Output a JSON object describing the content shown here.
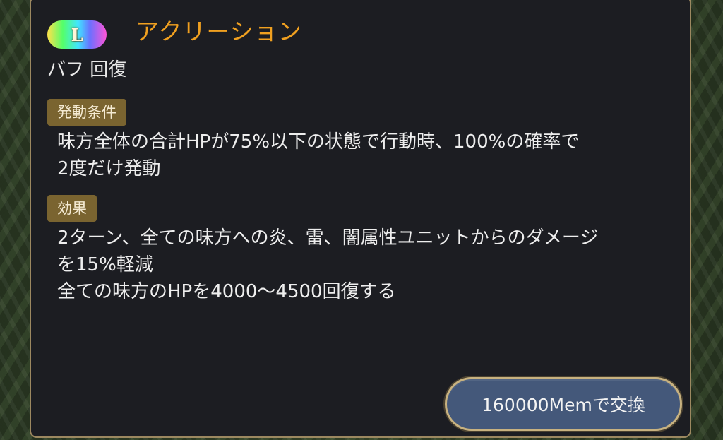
{
  "skill": {
    "rarity": "L",
    "name": "アクリーション",
    "type": "バフ 回復"
  },
  "sections": {
    "condition": {
      "label": "発動条件",
      "lines": [
        "味方全体の合計HPが75%以下の状態で行動時、100%の確率で",
        "2度だけ発動"
      ]
    },
    "effect": {
      "label": "効果",
      "lines": [
        "2ターン、全ての味方への炎、雷、闇属性ユニットからのダメージ",
        "を15%軽減",
        "全ての味方のHPを4000〜4500回復する"
      ]
    }
  },
  "exchange_button": {
    "label": "160000Memで交換"
  },
  "colors": {
    "skill_name": "#f0a020",
    "panel_bg": "#1c1d22",
    "panel_border": "#9c8860",
    "tag_bg": "#7a6430",
    "button_bg": "#44587a"
  }
}
